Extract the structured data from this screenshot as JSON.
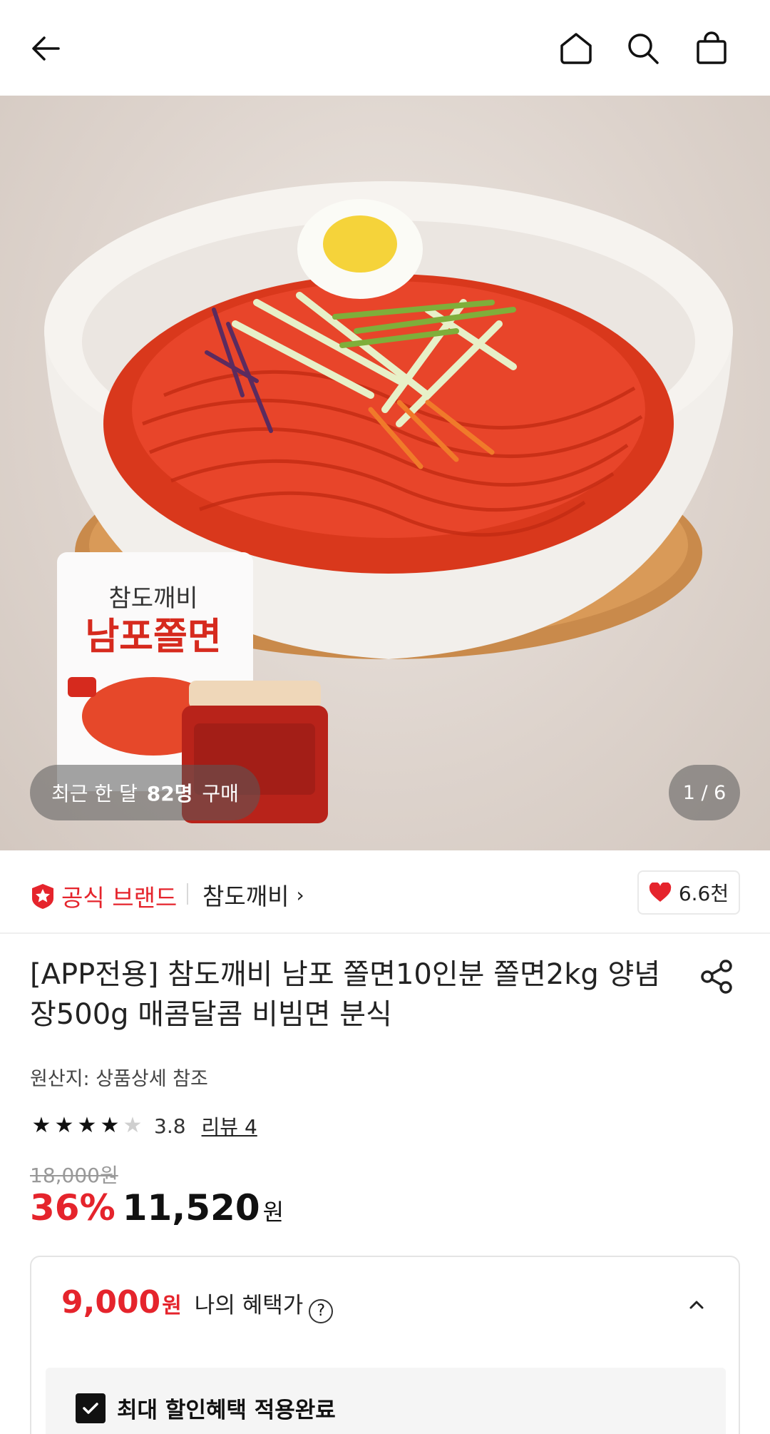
{
  "topbar": {
    "icons": [
      "back-arrow-icon",
      "home-icon",
      "search-icon",
      "shopping-bag-icon"
    ]
  },
  "hero": {
    "recent_prefix": "최근 한 달",
    "recent_count": "82명",
    "recent_suffix": "구매",
    "image_counter": "1 / 6"
  },
  "brand": {
    "badge_label": "공식 브랜드",
    "name": "참도깨비",
    "chevron": "›",
    "likes": "6.6천",
    "accent_color": "#e5242c"
  },
  "product": {
    "title": "[APP전용] 참도깨비 남포 쫄면10인분 쫄면2kg 양념장500g 매콤달콤 비빔면 분식",
    "origin": "원산지: 상품상세 참조",
    "rating": "3.8",
    "rating_value": 3.8,
    "review_link": "리뷰 4",
    "original_price": "18,000원",
    "discount_rate": "36%",
    "sale_price": "11,520",
    "currency": "원"
  },
  "benefit": {
    "price": "9,000",
    "currency": "원",
    "label": "나의 혜택가",
    "help": "?",
    "applied_label": "최대 할인혜택 적용완료"
  }
}
